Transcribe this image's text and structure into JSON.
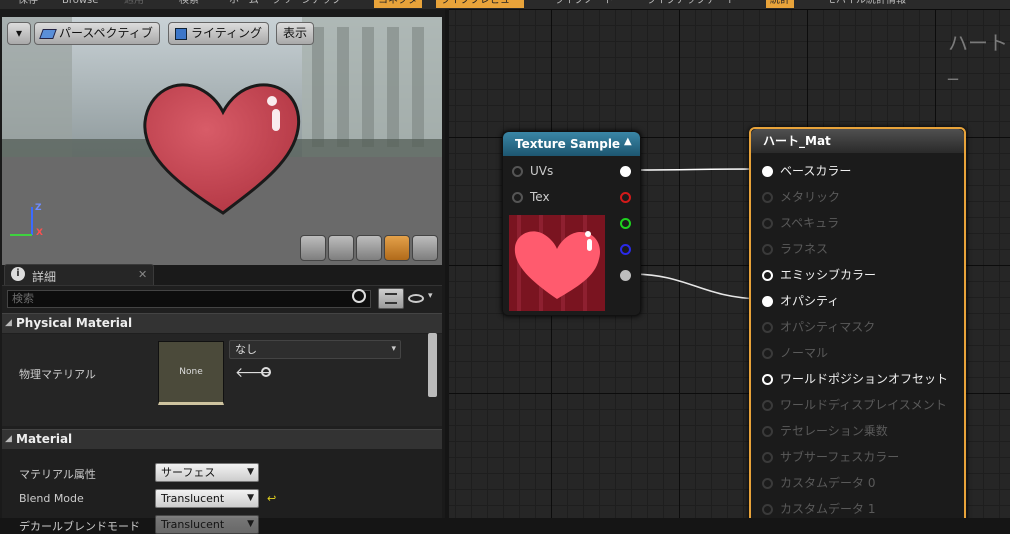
{
  "toolbar": {
    "items": [
      "保存",
      "Browse",
      "適用",
      "検索",
      "ホーム",
      "クリーンアップ",
      "コネクタ",
      "ライブプレビュー",
      "ライブノード",
      "ライブアップデート",
      "統計",
      "モバイル統計情報"
    ]
  },
  "viewport": {
    "menu_icon": "chevron-down-icon",
    "perspective_label": "パースペクティブ",
    "lighting_label": "ライティング",
    "show_label": "表示",
    "axis_z": "Z",
    "axis_x": "X",
    "preview_tools": [
      "cylinder-icon",
      "sphere-icon",
      "plane-icon",
      "cube-icon",
      "teapot-icon"
    ]
  },
  "details": {
    "tab_label": "詳細",
    "search_placeholder": "検索",
    "sections": [
      {
        "title": "Physical Material"
      },
      {
        "title": "Material"
      }
    ],
    "physical_material": {
      "label": "物理マテリアル",
      "thumb_text": "None",
      "value": "なし"
    },
    "material_props": [
      {
        "label": "マテリアル属性",
        "value": "サーフェス"
      },
      {
        "label": "Blend Mode",
        "value": "Translucent"
      },
      {
        "label": "デカールブレンドモード",
        "value": "Translucent"
      }
    ]
  },
  "graph": {
    "watermark": "ハート_",
    "texture_node": {
      "title": "Texture Sample",
      "inputs": [
        "UVs",
        "Tex"
      ],
      "output_colors": [
        "#ffffff",
        "#d21a1a",
        "#1fd21f",
        "#2a2ae8",
        "#bdbdbd"
      ]
    },
    "material_node": {
      "title": "ハート_Mat",
      "pins": [
        {
          "label": "ベースカラー",
          "state": "connected"
        },
        {
          "label": "メタリック",
          "state": "disabled"
        },
        {
          "label": "スペキュラ",
          "state": "disabled"
        },
        {
          "label": "ラフネス",
          "state": "disabled"
        },
        {
          "label": "エミッシブカラー",
          "state": "enabled"
        },
        {
          "label": "オパシティ",
          "state": "connected"
        },
        {
          "label": "オパシティマスク",
          "state": "disabled"
        },
        {
          "label": "ノーマル",
          "state": "disabled"
        },
        {
          "label": "ワールドポジションオフセット",
          "state": "enabled"
        },
        {
          "label": "ワールドディスプレイスメント",
          "state": "disabled"
        },
        {
          "label": "テセレーション乗数",
          "state": "disabled"
        },
        {
          "label": "サブサーフェスカラー",
          "state": "disabled"
        },
        {
          "label": "カスタムデータ 0",
          "state": "disabled"
        },
        {
          "label": "カスタムデータ 1",
          "state": "disabled"
        }
      ]
    }
  },
  "colors": {
    "accent_orange": "#e8a33a",
    "node_header_blue": "#2f6f8a",
    "heart_red": "#c9424e"
  }
}
